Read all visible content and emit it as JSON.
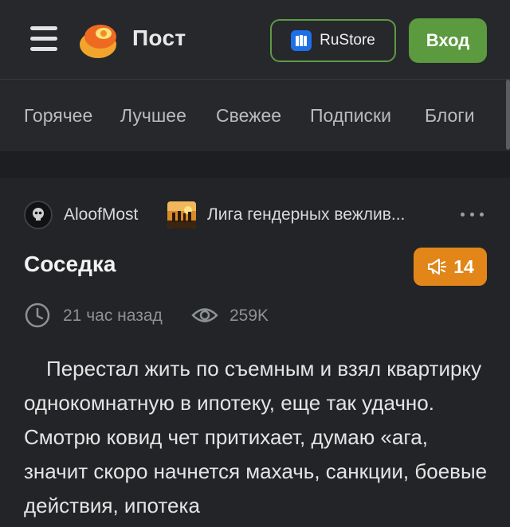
{
  "header": {
    "logo_text": "Пост",
    "rustore_label": "RuStore",
    "login_label": "Вход"
  },
  "tabs": [
    {
      "label": "Горячее"
    },
    {
      "label": "Лучшее"
    },
    {
      "label": "Свежее"
    },
    {
      "label": "Подписки"
    },
    {
      "label": "Блоги"
    }
  ],
  "post": {
    "author": "AloofMost",
    "community": "Лига гендерных вежлив...",
    "title": "Соседка",
    "rating": "14",
    "time": "21 час назад",
    "views": "259K",
    "body": "Перестал жить по съемным и взял квартирку однокомнатную в ипотеку, еще так удачно. Смотрю ковид чет притихает, думаю «ага, значит скоро начнется махачь, санкции, боевые действия, ипотека"
  },
  "colors": {
    "background": "#222427",
    "header": "#26282c",
    "accent_green": "#5b9a3e",
    "rating_orange": "#e2861a",
    "rustore_blue": "#1e70e6"
  },
  "icons": {
    "menu": "hamburger-icon",
    "logo": "logo-icon",
    "rustore": "rustore-icon",
    "more": "more-dots-icon",
    "rating": "megaphone-icon",
    "time": "clock-icon",
    "views": "eye-icon"
  }
}
